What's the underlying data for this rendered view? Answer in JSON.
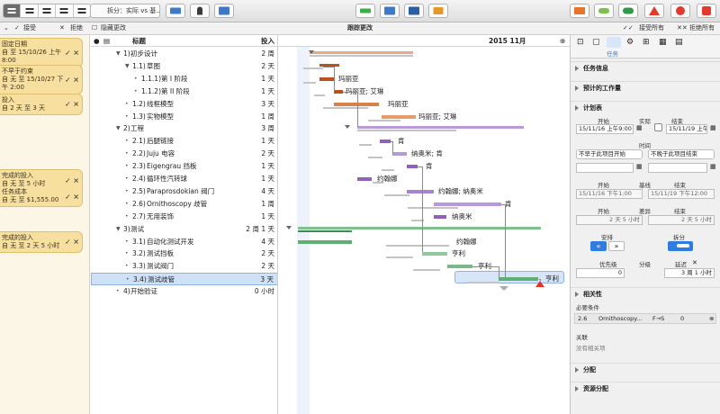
{
  "toolbar": {
    "baseline_select": "拆分：实际 vs 基...",
    "icons": [
      "view-switcher-icon",
      "tree-icon",
      "network-icon",
      "resources-icon",
      "inspector-icon",
      "level-icon",
      "violation-icon",
      "share-icon",
      "catch-up-icon",
      "snapshot-icon",
      "calendar-icon",
      "baseline-icon",
      "cloud-publish-icon",
      "warning-icon",
      "stop-tracking-icon",
      "view-options-icon"
    ]
  },
  "changes_bar": {
    "accept": "接受",
    "reject": "拒绝",
    "hide_changes": "隐藏更改",
    "title": "跟踪更改",
    "accept_all": "接受所有",
    "reject_all": "拒绝所有"
  },
  "changes": [
    {
      "title": "固定日期",
      "text": "自 至 15/10/26 上午 8:00"
    },
    {
      "title": "不早于约束",
      "text": "自 无 至 15/10/27 下午 2:00"
    },
    {
      "title": "投入",
      "text": "自 2 天 至 3 天"
    },
    {
      "title": "完成的投入",
      "text": "自 无 至 5 小时"
    },
    {
      "title": "任务成本",
      "text": "自 无 至 $1,555.00"
    },
    {
      "title": "完成的投入",
      "text": "自 无 至 2 天 5 小时"
    }
  ],
  "outline": {
    "col_title": "标题",
    "col_effort": "投入",
    "rows": [
      {
        "num": "1)",
        "title": "初步设计",
        "effort": "2 周"
      },
      {
        "num": "1.1)",
        "title": "草图",
        "effort": "2 天"
      },
      {
        "num": "1.1.1)",
        "title": "第 I 阶段",
        "effort": "1 天"
      },
      {
        "num": "1.1.2)",
        "title": "第 II 阶段",
        "effort": "1 天"
      },
      {
        "num": "1.2)",
        "title": "线框模型",
        "effort": "3 天"
      },
      {
        "num": "1.3)",
        "title": "实物模型",
        "effort": "1 周"
      },
      {
        "num": "2)",
        "title": "工程",
        "effort": "3 周"
      },
      {
        "num": "2.1)",
        "title": "后腿链接",
        "effort": "1 天"
      },
      {
        "num": "2.2)",
        "title": "Juju 电容",
        "effort": "2 天"
      },
      {
        "num": "2.3)",
        "title": "Eigengrau 挡板",
        "effort": "1 天"
      },
      {
        "num": "2.4)",
        "title": "循环性汽转球",
        "effort": "1 天"
      },
      {
        "num": "2.5)",
        "title": "Paraprosdokian 阀门",
        "effort": "4 天"
      },
      {
        "num": "2.6)",
        "title": "Ornithoscopy 歧管",
        "effort": "1 周"
      },
      {
        "num": "2.7)",
        "title": "无用装饰",
        "effort": "1 天"
      },
      {
        "num": "3)",
        "title": "测试",
        "effort": "2 周 1 天"
      },
      {
        "num": "3.1)",
        "title": "自动化测试开发",
        "effort": "4 天"
      },
      {
        "num": "3.2)",
        "title": "测试挡板",
        "effort": "2 天"
      },
      {
        "num": "3.3)",
        "title": "测试阀门",
        "effort": "2 天"
      },
      {
        "num": "3.4)",
        "title": "测试歧管",
        "effort": "3 天"
      },
      {
        "num": "4)",
        "title": "开始验证",
        "effort": "0 小时"
      }
    ]
  },
  "gantt": {
    "month": "2015 11月",
    "labels": [
      "玛丽亚",
      "玛丽亚; 艾琳",
      "玛丽亚",
      "玛丽亚; 艾琳",
      "肯",
      "纳奥米; 肯",
      "肯",
      "约翰娜",
      "约翰娜; 纳奥米",
      "肯",
      "纳奥米",
      "约翰娜",
      "亨利",
      "亨利",
      "亨利"
    ]
  },
  "inspector": {
    "tab_caption": "任务",
    "sections": {
      "task_info": "任务信息",
      "planned_effort": "预计的工作量",
      "plan": "计划表",
      "dependencies": "相关性",
      "assignments": "分配",
      "resource_assignment": "资源分配"
    },
    "start_label": "开始",
    "actual_label": "实际",
    "end_label": "结束",
    "start_value": "15/11/16 上午9:00",
    "end_value": "15/11/19 上午9:00",
    "time_label": "时间",
    "start_constraint": "不早于此项目开始",
    "end_constraint": "不晚于此项目结束",
    "baseline_start_label": "开始",
    "baseline_label": "基线",
    "baseline_end_label": "结束",
    "baseline_start": "15/11/16 下午1:00",
    "baseline_end": "15/11/19 下午12:00",
    "var_start_label": "开始",
    "variance_label": "差异",
    "var_end_label": "结束",
    "var_start": "2 天 5 小时",
    "var_end": "2 天 5 小时",
    "schedule_label": "安排",
    "split_label": "拆分",
    "priority_label": "优先级",
    "leveling_label": "分级",
    "delay_label": "延迟",
    "priority_value": "0",
    "delay_value": "3 周 1 小时",
    "prerequisites_label": "必要条件",
    "prereq_num": "2.6",
    "prereq_name": "Ornithoscopy...",
    "prereq_type": "F→S",
    "prereq_lag": "0",
    "related_label": "关联",
    "no_related": "没有相关项"
  },
  "colors": {
    "accent": "#2f7de1",
    "change_note": "#f7dfa0",
    "phase1": "#b8531e",
    "phase2": "#8e62b8",
    "phase3": "#4e9e62",
    "baseline": "#c4c4c4"
  }
}
